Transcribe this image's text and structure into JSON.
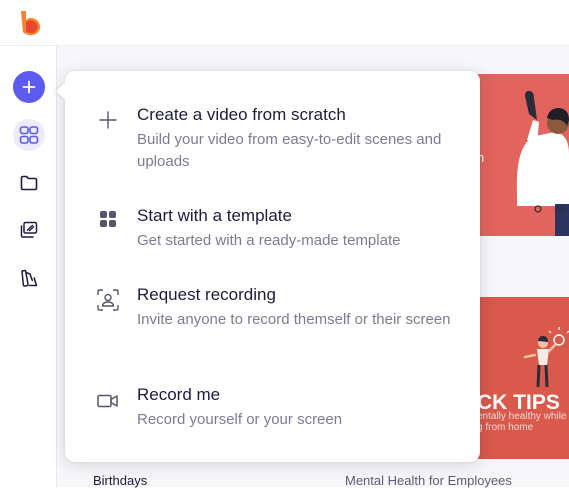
{
  "sidebar": {
    "buttons": [
      {
        "icon": "plus-icon"
      },
      {
        "icon": "grid-icon"
      },
      {
        "icon": "folder-icon"
      },
      {
        "icon": "media-library-icon"
      },
      {
        "icon": "brand-palette-icon"
      }
    ],
    "accent": "#5b5bf0"
  },
  "menu": {
    "items": [
      {
        "title": "Create a video from scratch",
        "description": "Build your video from easy-to-edit scenes and uploads",
        "icon": "plus-icon"
      },
      {
        "title": "Start with a template",
        "description": "Get started with a ready-made template",
        "icon": "template-grid-icon"
      },
      {
        "title": "Request recording",
        "description": "Invite anyone to record themself or their screen",
        "icon": "request-recording-icon"
      },
      {
        "title": "Record me",
        "description": "Record yourself or your screen",
        "icon": "video-camera-icon"
      }
    ]
  },
  "cards": {
    "card1": {
      "color": "#e2645c"
    },
    "card2": {
      "color": "#d9594b",
      "title": "CK TIPS",
      "subtitle_line1": "entally healthy while",
      "subtitle_line2": "g from home"
    },
    "labels": [
      "Birthdays",
      "Mental Health for Employees"
    ]
  }
}
